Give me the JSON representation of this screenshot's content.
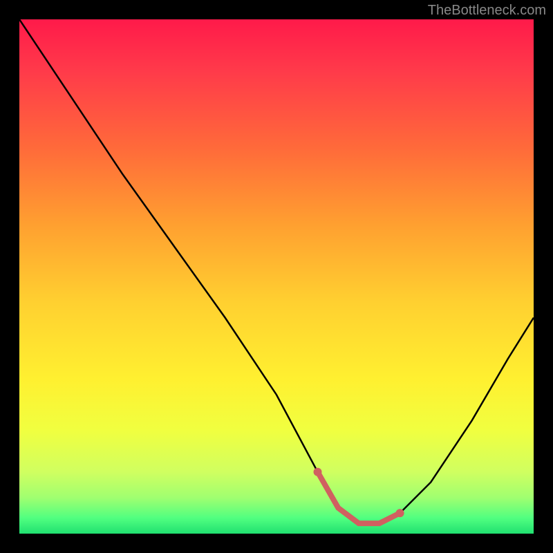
{
  "watermark": "TheBottleneck.com",
  "chart_data": {
    "type": "line",
    "title": "",
    "xlabel": "",
    "ylabel": "",
    "xlim": [
      0,
      100
    ],
    "ylim": [
      0,
      100
    ],
    "series": [
      {
        "name": "bottleneck-curve",
        "x": [
          0,
          10,
          20,
          30,
          40,
          50,
          58,
          62,
          66,
          70,
          74,
          80,
          88,
          95,
          100
        ],
        "values": [
          100,
          85,
          70,
          56,
          42,
          27,
          12,
          5,
          2,
          2,
          4,
          10,
          22,
          34,
          42
        ]
      }
    ],
    "highlight": {
      "name": "optimal-range",
      "x": [
        58,
        62,
        66,
        70,
        74
      ],
      "values": [
        12,
        5,
        2,
        2,
        4
      ],
      "color": "#d06060"
    },
    "gradient_stops": [
      {
        "pos": 0,
        "color": "#ff1a4a"
      },
      {
        "pos": 50,
        "color": "#ffd030"
      },
      {
        "pos": 100,
        "color": "#20e070"
      }
    ]
  }
}
